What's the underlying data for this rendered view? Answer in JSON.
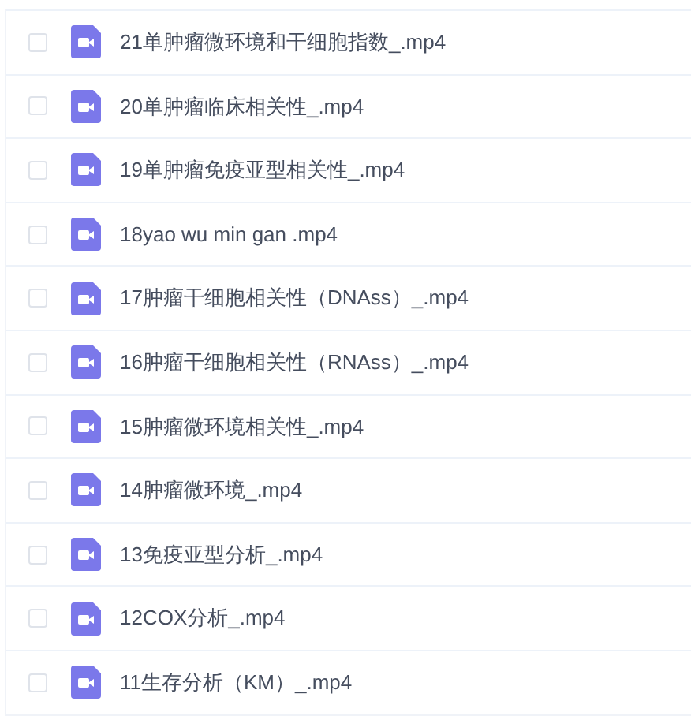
{
  "files": [
    {
      "name": "21单肿瘤微环境和干细胞指数_.mp4",
      "checked": false
    },
    {
      "name": "20单肿瘤临床相关性_.mp4",
      "checked": false
    },
    {
      "name": "19单肿瘤免疫亚型相关性_.mp4",
      "checked": false
    },
    {
      "name": "18yao wu min gan .mp4",
      "checked": false
    },
    {
      "name": "17肿瘤干细胞相关性（DNAss）_.mp4",
      "checked": false
    },
    {
      "name": "16肿瘤干细胞相关性（RNAss）_.mp4",
      "checked": false
    },
    {
      "name": "15肿瘤微环境相关性_.mp4",
      "checked": false
    },
    {
      "name": "14肿瘤微环境_.mp4",
      "checked": false
    },
    {
      "name": "13免疫亚型分析_.mp4",
      "checked": false
    },
    {
      "name": "12COX分析_.mp4",
      "checked": false
    },
    {
      "name": "11生存分析（KM）_.mp4",
      "checked": false
    }
  ]
}
